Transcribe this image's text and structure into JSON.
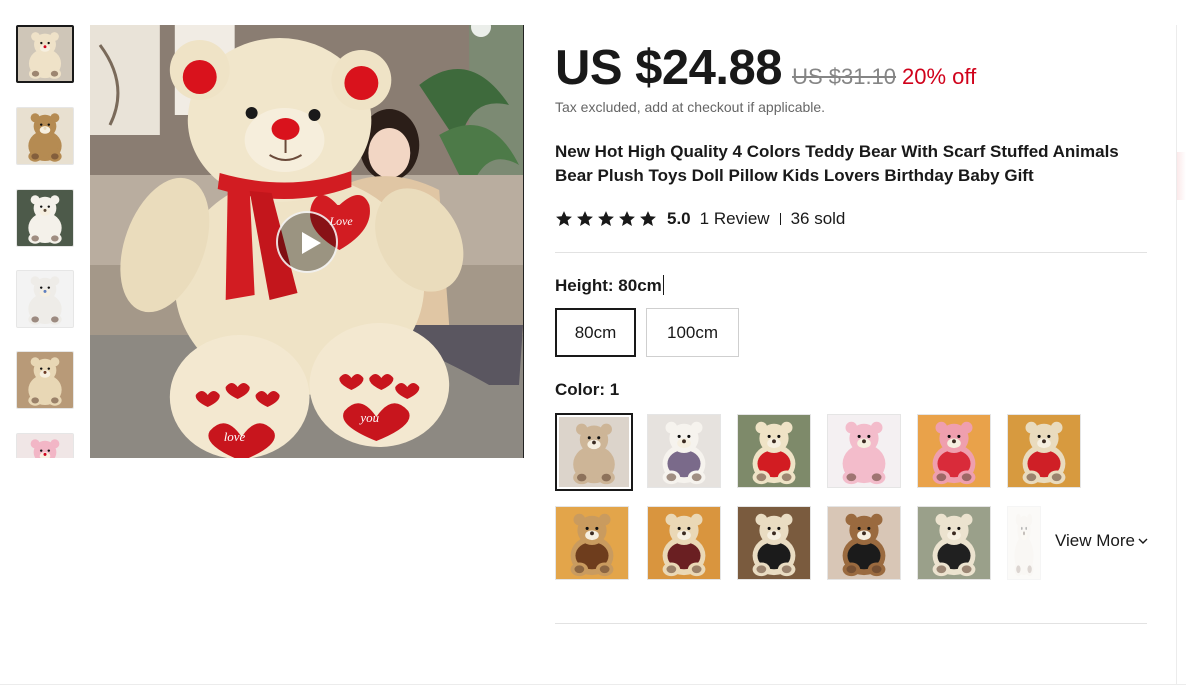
{
  "gallery": {
    "thumbnails": [
      {
        "name": "thumb-cream-red-scarf",
        "bear_color": "#efe2c8",
        "accent": "#d0021b",
        "bg": "#cfc6b8"
      },
      {
        "name": "thumb-brown-bear",
        "bear_color": "#b58b52",
        "accent": "#e8d9b8",
        "bg": "#e8e0d0"
      },
      {
        "name": "thumb-white-bear",
        "bear_color": "#f4f1ea",
        "accent": "#5a4a3a",
        "bg": "#4d5a4a"
      },
      {
        "name": "thumb-small-white-bear",
        "bear_color": "#eeece8",
        "accent": "#5f7fbf",
        "bg": "#f3f3f3"
      },
      {
        "name": "thumb-cream-brown-scarf",
        "bear_color": "#e8d7b5",
        "accent": "#6b3a25",
        "bg": "#b89a78"
      },
      {
        "name": "thumb-pink-bear",
        "bear_color": "#f2b6c6",
        "accent": "#d0021b",
        "bg": "#f0e6e6"
      }
    ],
    "main_image": {
      "bear_color": "#efe3c6",
      "scarf_color": "#d21c22",
      "heart_text": "Love",
      "left_paw_text": "love",
      "right_paw_text": "you"
    },
    "play_label": "play-video"
  },
  "price": {
    "current": "US $24.88",
    "original": "US $31.10",
    "discount": "20% off",
    "tax_note": "Tax excluded, add at checkout if applicable."
  },
  "product": {
    "title": "New Hot High Quality 4 Colors Teddy Bear With Scarf Stuffed Animals Bear Plush Toys Doll Pillow Kids Lovers Birthday Baby Gift"
  },
  "rating": {
    "stars": 5,
    "score": "5.0",
    "reviews": "1 Review",
    "sold": "36 sold"
  },
  "height": {
    "label": "Height: ",
    "selected": "80cm",
    "options": [
      "80cm",
      "100cm"
    ]
  },
  "color": {
    "label": "Color: ",
    "selected": "1",
    "swatches": [
      {
        "name": "swatch-brown-beige",
        "bear": "#cdb597",
        "shirt": "#cdb597",
        "bg": "#dcd4cb",
        "selected": true
      },
      {
        "name": "swatch-white-purple-scarf",
        "bear": "#f6f3ee",
        "shirt": "#7a6a8a",
        "bg": "#e6e2de"
      },
      {
        "name": "swatch-cream-red-scarf",
        "bear": "#efe3c6",
        "shirt": "#d21c22",
        "bg": "#7e8a6a"
      },
      {
        "name": "swatch-pink-bear",
        "bear": "#f3bccb",
        "shirt": "#f3bccb",
        "bg": "#f4f0f2"
      },
      {
        "name": "swatch-pink-red-shirt",
        "bear": "#ef9fae",
        "shirt": "#d92b3a",
        "bg": "#e9a24a"
      },
      {
        "name": "swatch-cream-red-shirt",
        "bear": "#e9dbbe",
        "shirt": "#cf1f26",
        "bg": "#d79a3f"
      },
      {
        "name": "swatch-tan-brown-shirt",
        "bear": "#c99b5f",
        "shirt": "#6e3d1d",
        "bg": "#e3a54a"
      },
      {
        "name": "swatch-cream-maroon-shirt",
        "bear": "#ead8b6",
        "shirt": "#6a1f22",
        "bg": "#d9953e"
      },
      {
        "name": "swatch-cream-black-iloveyou",
        "bear": "#e9dcc2",
        "shirt": "#1b1b1b",
        "bg": "#7a5b3e"
      },
      {
        "name": "swatch-brown-black-iloveyou",
        "bear": "#9a6a3f",
        "shirt": "#1b1b1b",
        "bg": "#d8c6b6"
      },
      {
        "name": "swatch-cream-black-shirt",
        "bear": "#ece3cf",
        "shirt": "#202020",
        "bg": "#9aa08a"
      },
      {
        "name": "swatch-partial-white",
        "bear": "#efeae2",
        "shirt": "#efeae2",
        "bg": "#f4f1ec"
      }
    ],
    "view_more": "View More"
  },
  "colors": {
    "text": "#191919",
    "muted": "#858585",
    "discount": "#d0021b",
    "border": "#cfcfcf"
  }
}
